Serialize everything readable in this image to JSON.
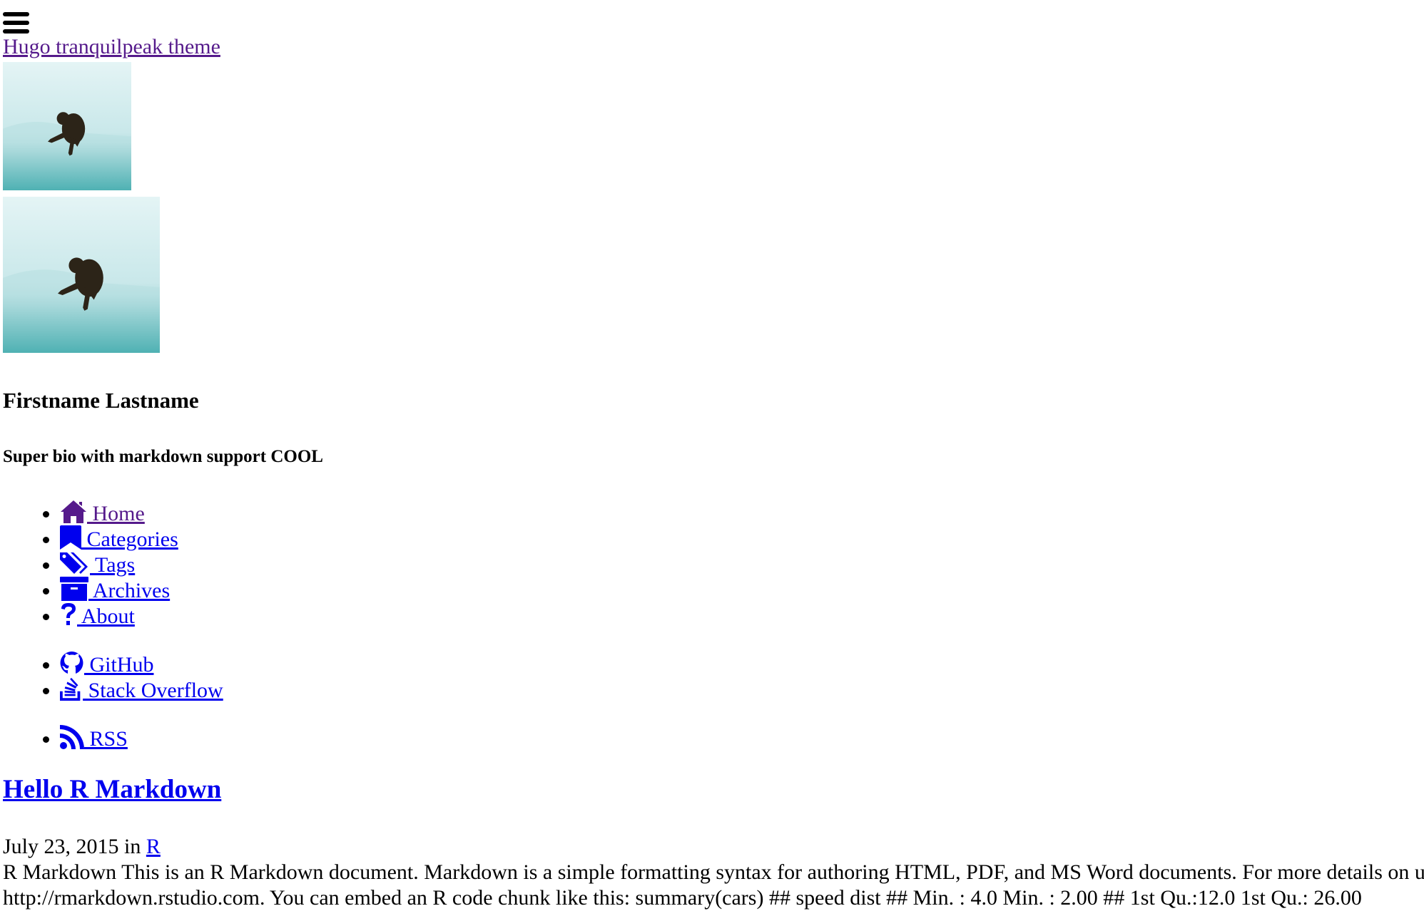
{
  "header": {
    "menu_icon": "hamburger-icon",
    "site_title": "Hugo tranquilpeak theme"
  },
  "sidebar": {
    "avatar_small_alt": "Author avatar",
    "avatar_large_alt": "Author picture",
    "author_name": "Firstname Lastname",
    "author_bio": "Super bio with markdown support COOL",
    "main_menu": [
      {
        "icon": "home-icon",
        "label": " Home"
      },
      {
        "icon": "bookmark-icon",
        "label": " Categories"
      },
      {
        "icon": "tags-icon",
        "label": " Tags"
      },
      {
        "icon": "archive-icon",
        "label": " Archives"
      },
      {
        "icon": "question-icon",
        "label": " About"
      }
    ],
    "social_menu": [
      {
        "icon": "github-icon",
        "label": " GitHub"
      },
      {
        "icon": "stack-overflow-icon",
        "label": " Stack Overflow"
      }
    ],
    "rss_menu": [
      {
        "icon": "rss-icon",
        "label": " RSS"
      }
    ]
  },
  "post": {
    "title": "Hello R Markdown",
    "date": "July 23, 2015",
    "in_label": " in ",
    "category": "R",
    "body_lines": [
      "R Markdown This is an R Markdown document. Markdown is a simple formatting syntax for authoring HTML, PDF, and MS Word documents. For more details on using R Markdown see",
      "http://rmarkdown.rstudio.com. You can embed an R code chunk like this: summary(cars) ## speed dist ## Min. : 4.0 Min. : 2.00 ## 1st Qu.:12.0 1st Qu.: 26.00"
    ]
  },
  "colors": {
    "link": "#0000EE",
    "visited_link": "#551A8B",
    "text": "#000000",
    "background": "#FFFFFF"
  }
}
